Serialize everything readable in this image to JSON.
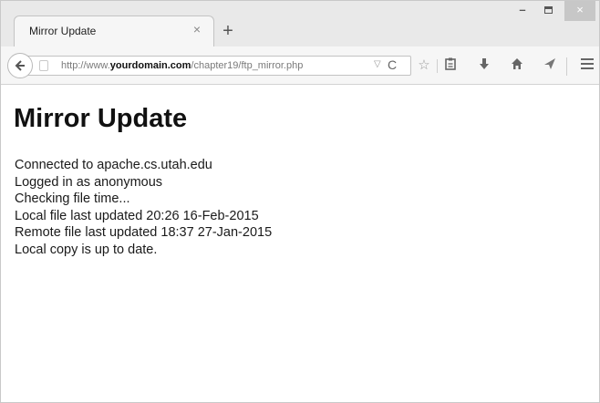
{
  "tab": {
    "title": "Mirror Update",
    "close": "×",
    "new_tab": "+"
  },
  "window_controls": {
    "minimize": "–",
    "close": "×"
  },
  "url": {
    "prefix": "http://www.",
    "domain": "yourdomain.com",
    "path": "/chapter19/ftp_mirror.php"
  },
  "icons": {
    "back": "back-arrow-icon",
    "reload": "reload-icon",
    "bookmark": "star-icon",
    "reading_list": "clipboard-icon",
    "download": "download-icon",
    "home": "home-icon",
    "share": "send-icon",
    "menu": "hamburger-menu-icon"
  },
  "page": {
    "title": "Mirror Update",
    "lines": [
      "Connected to apache.cs.utah.edu",
      "Logged in as anonymous",
      "Checking file time...",
      "Local file last updated 20:26 16-Feb-2015",
      "Remote file last updated 18:37 27-Jan-2015",
      "Local copy is up to date."
    ]
  }
}
